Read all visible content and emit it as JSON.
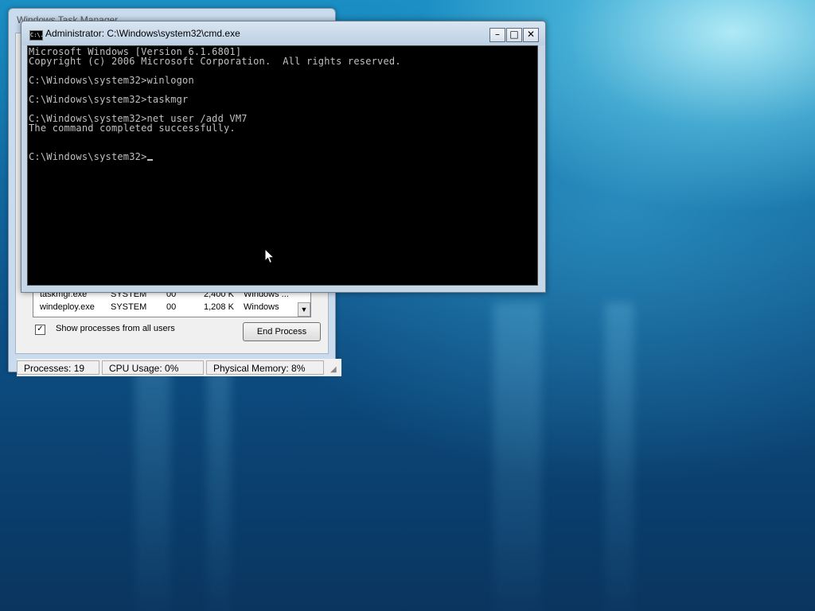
{
  "desktop": {
    "background_colors": [
      "#1a8fc4",
      "#0d4f84",
      "#0a355f"
    ]
  },
  "taskmgr": {
    "title": "Windows Task Manager",
    "process_rows": [
      {
        "name": "taskmgr.exe",
        "user": "SYSTEM",
        "cpu": "00",
        "memory": "2,400 K",
        "description": "Windows ..."
      },
      {
        "name": "windeploy.exe",
        "user": "SYSTEM",
        "cpu": "00",
        "memory": "1,208 K",
        "description": "Windows"
      }
    ],
    "show_all_label": "Show processes from all users",
    "show_all_checked": true,
    "end_process_label": "End Process",
    "status": {
      "processes": "Processes: 19",
      "cpu": "CPU Usage: 0%",
      "memory": "Physical Memory: 8%"
    }
  },
  "cmd": {
    "title": "Administrator: C:\\Windows\\system32\\cmd.exe",
    "icon_text": "C:\\.",
    "buttons": {
      "minimize": "–",
      "maximize": "□",
      "close": "✕"
    },
    "lines": [
      "Microsoft Windows [Version 6.1.6801]",
      "Copyright (c) 2006 Microsoft Corporation.  All rights reserved.",
      "",
      "C:\\Windows\\system32>winlogon",
      "",
      "C:\\Windows\\system32>taskmgr",
      "",
      "C:\\Windows\\system32>net user /add VM7",
      "The command completed successfully.",
      "",
      "",
      "C:\\Windows\\system32>"
    ],
    "text_color": "#c0c0c0",
    "background_color": "#000000"
  },
  "pointer": {
    "icon": "mouse-pointer-icon"
  }
}
